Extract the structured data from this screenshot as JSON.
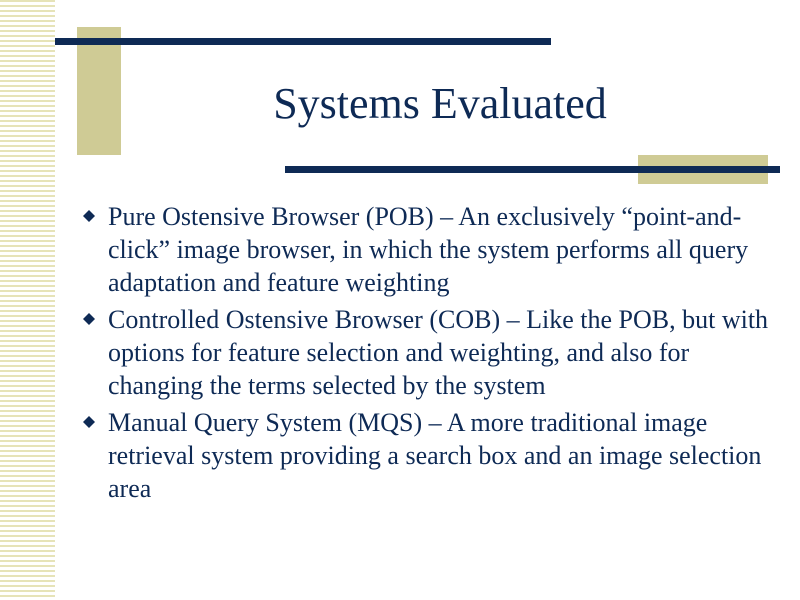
{
  "slide": {
    "title": "Systems Evaluated",
    "bullets": [
      {
        "text": "Pure Ostensive Browser (POB) – An exclusively “point-and-click” image browser, in which the system performs all query adaptation and feature weighting"
      },
      {
        "text": "Controlled Ostensive Browser (COB) – Like the POB, but with options for feature selection and weighting, and also for changing the terms selected by the system"
      },
      {
        "text": "Manual Query System (MQS) – A more traditional image retrieval system providing a search box and an image selection area"
      }
    ]
  },
  "icons": {
    "bullet": "diamond-bullet-icon"
  },
  "colors": {
    "text": "#0e2a55",
    "accent": "#cfcb95",
    "stripes": "#e6e3b8",
    "background": "#ffffff"
  }
}
